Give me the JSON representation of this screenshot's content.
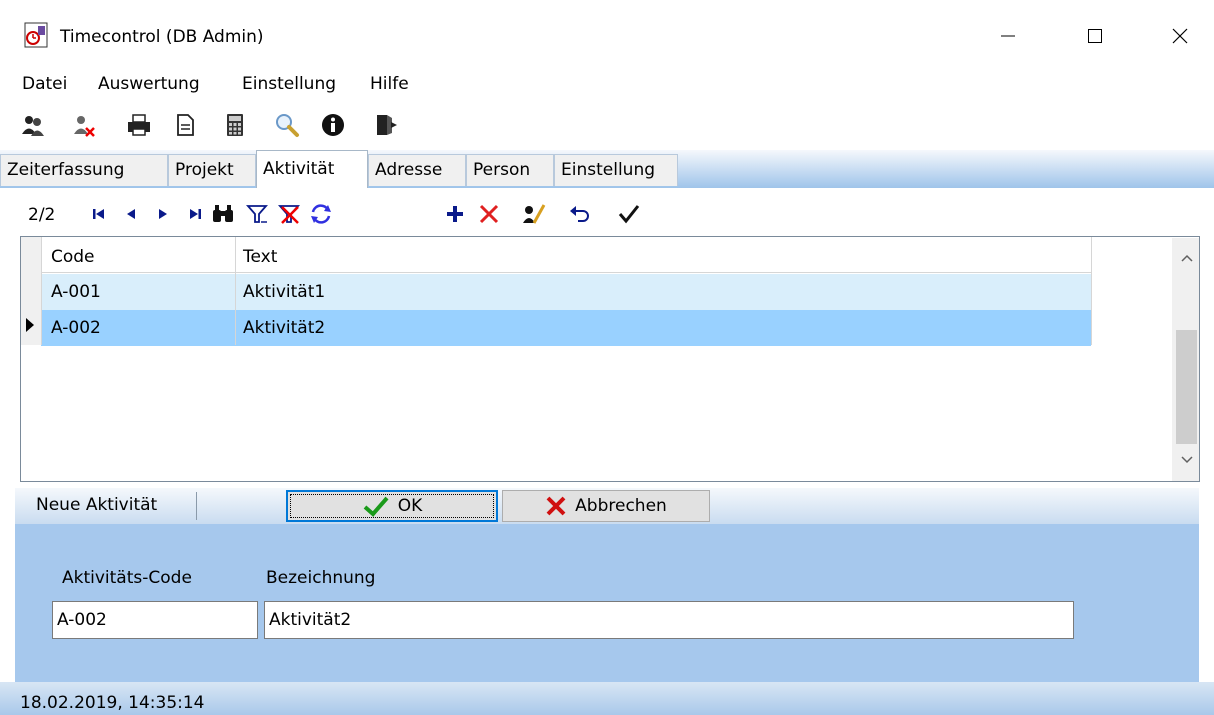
{
  "window": {
    "title": "Timecontrol (DB Admin)"
  },
  "menu": [
    "Datei",
    "Auswertung",
    "Einstellung",
    "Hilfe"
  ],
  "toolbar": {
    "icons": [
      "users-icon",
      "user-remove-icon",
      "print-icon",
      "document-icon",
      "calculator-icon",
      "search-icon",
      "info-icon",
      "exit-icon"
    ]
  },
  "tabs": [
    "Zeiterfassung",
    "Projekt",
    "Aktivität",
    "Adresse",
    "Person",
    "Einstellung"
  ],
  "active_tab": "Aktivität",
  "navigator": {
    "record_position": "2/2"
  },
  "grid": {
    "columns": [
      "Code",
      "Text"
    ],
    "rows": [
      {
        "code": "A-001",
        "text": "Aktivität1"
      },
      {
        "code": "A-002",
        "text": "Aktivität2"
      }
    ],
    "selected_row": 2
  },
  "edit_bar": {
    "label": "Neue Aktivität",
    "ok_label": "OK",
    "cancel_label": "Abbrechen"
  },
  "form": {
    "code_label": "Aktivitäts-Code",
    "code_value": "A-002",
    "name_label": "Bezeichnung",
    "name_value": "Aktivität2"
  },
  "status": {
    "datetime": "18.02.2019, 14:35:14"
  },
  "colors": {
    "selected_row": "#99d1ff",
    "alt_row": "#d9eefb",
    "panel": "#a6c8ed",
    "ok_focus": "#0078d7"
  }
}
